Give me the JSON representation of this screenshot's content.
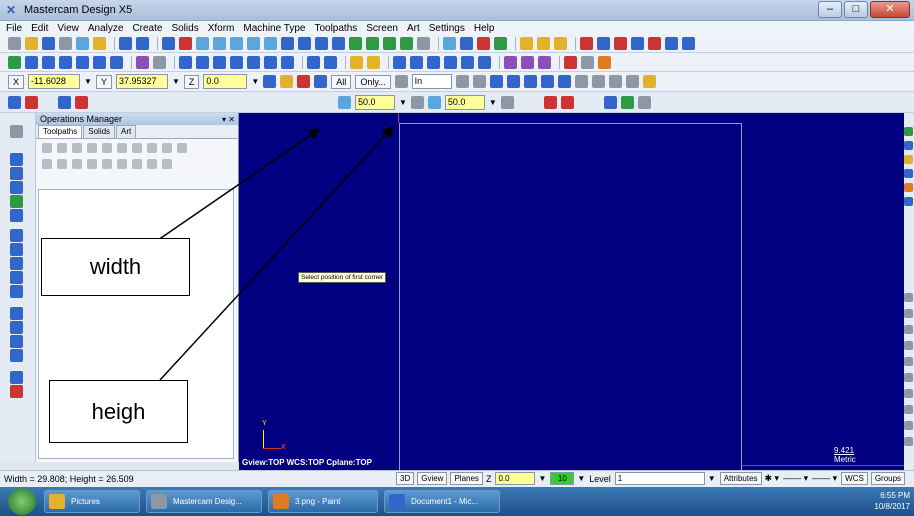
{
  "window": {
    "title": "Mastercam Design X5",
    "controls": [
      "–",
      "□",
      "✕"
    ]
  },
  "menubar": [
    "File",
    "Edit",
    "View",
    "Analyze",
    "Create",
    "Solids",
    "Xform",
    "Machine Type",
    "Toolpaths",
    "Screen",
    "Art",
    "Settings",
    "Help"
  ],
  "coords": {
    "x_label": "X",
    "x_value": "-11.6028",
    "y_label": "Y",
    "y_value": "37.95327",
    "z_label": "Z",
    "z_value": "0.0",
    "all_label": "All",
    "only_label": "Only...",
    "in_label": "In"
  },
  "ribbon": {
    "width_value": "50.0",
    "height_value": "50.0"
  },
  "ops_manager": {
    "title": "Operations Manager",
    "tabs": [
      "Toolpaths",
      "Solids",
      "Art"
    ]
  },
  "viewport": {
    "tooltip": "Select position of first corner",
    "view_status": "Gview:TOP  WCS:TOP  Cplane:TOP",
    "axis_y": "Y",
    "axis_x": "X",
    "scale_value": "9.421",
    "scale_unit": "Metric"
  },
  "annotations": {
    "width_label": "width",
    "height_label": "heigh"
  },
  "statusbar": {
    "dims": "Width = 29.808; Height = 26.509",
    "mode_3d": "3D",
    "gview": "Gview",
    "planes": "Planes",
    "z_label": "Z",
    "z_value": "0.0",
    "color_value": "10",
    "level_label": "Level",
    "level_value": "1",
    "attributes": "Attributes",
    "wcs": "WCS",
    "groups": "Groups"
  },
  "taskbar": {
    "tasks": [
      "Pictures",
      "Mastercam Desig...",
      "3.png - Paint",
      "Document1 - Mic..."
    ],
    "time": "6:55 PM",
    "date": "10/8/2017"
  },
  "colors": {
    "viewport_bg": "#000080",
    "accent": "#2f5da8"
  }
}
